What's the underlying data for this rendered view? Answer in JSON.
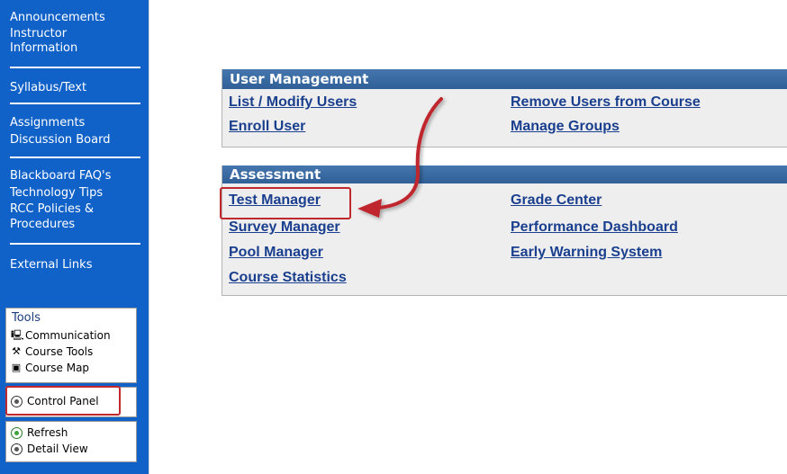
{
  "sidebar": {
    "nav_groups": [
      [
        "Announcements",
        "Instructor",
        "Information"
      ],
      [
        "Syllabus/Text"
      ],
      [
        "Assignments",
        "Discussion Board"
      ],
      [
        "Blackboard FAQ's",
        "Technology Tips",
        "RCC Policies &",
        "Procedures"
      ],
      [
        "External Links"
      ]
    ],
    "tools": {
      "title": "Tools",
      "items": [
        "Communication",
        "Course Tools",
        "Course Map"
      ]
    },
    "control_panel": "Control Panel",
    "refresh": "Refresh",
    "detail_view": "Detail View"
  },
  "user_management": {
    "title": "User Management",
    "links": {
      "list_modify": "List / Modify Users",
      "enroll": "Enroll User",
      "remove": "Remove Users from Course",
      "groups": "Manage Groups"
    }
  },
  "assessment": {
    "title": "Assessment",
    "links": {
      "test_manager": "Test Manager",
      "survey_manager": "Survey Manager",
      "pool_manager": "Pool Manager",
      "course_statistics": "Course Statistics",
      "grade_center": "Grade Center",
      "performance_dashboard": "Performance Dashboard",
      "early_warning": "Early Warning System"
    }
  },
  "colors": {
    "sidebar": "#1062c8",
    "panel_header": "#3b6fa8",
    "link": "#1a3f8e",
    "highlight": "#c0282d"
  }
}
